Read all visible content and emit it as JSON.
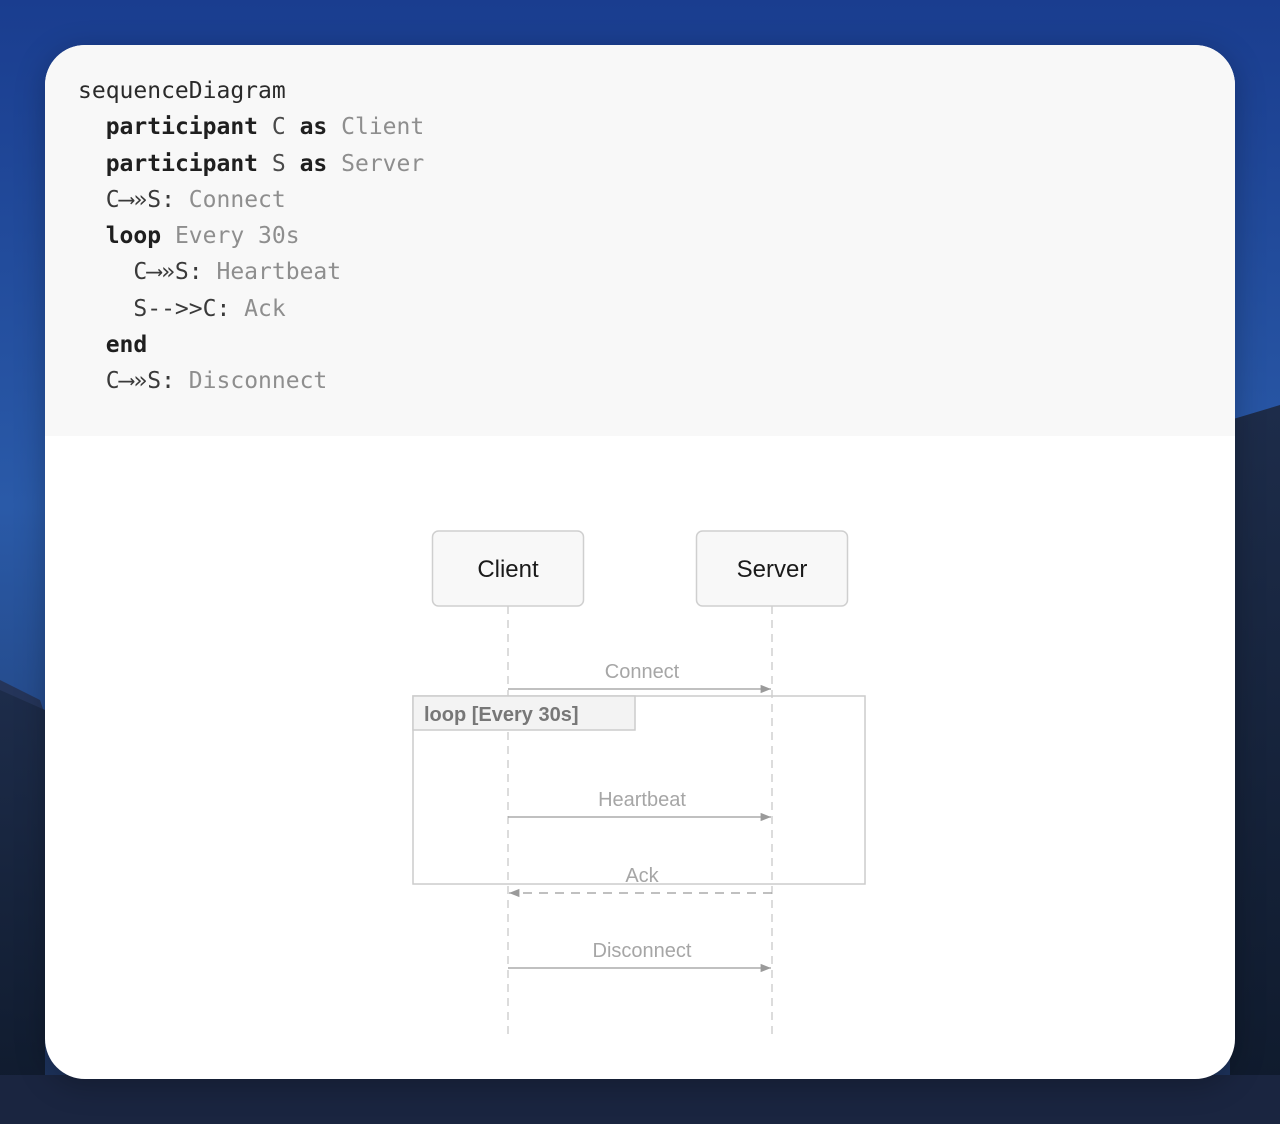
{
  "code": {
    "lines": [
      {
        "indent": "",
        "parts": [
          {
            "t": "sequenceDiagram",
            "c": "kw-plain"
          }
        ]
      },
      {
        "indent": "  ",
        "parts": [
          {
            "t": "participant",
            "c": "kw"
          },
          {
            "t": " C ",
            "c": "id"
          },
          {
            "t": "as",
            "c": "kw"
          },
          {
            "t": " Client",
            "c": "str"
          }
        ]
      },
      {
        "indent": "  ",
        "parts": [
          {
            "t": "participant",
            "c": "kw"
          },
          {
            "t": " S ",
            "c": "id"
          },
          {
            "t": "as",
            "c": "kw"
          },
          {
            "t": " Server",
            "c": "str"
          }
        ]
      },
      {
        "indent": "  ",
        "parts": [
          {
            "t": "C⟶»S:",
            "c": "op"
          },
          {
            "t": " Connect",
            "c": "str"
          }
        ]
      },
      {
        "indent": "  ",
        "parts": [
          {
            "t": "loop",
            "c": "kw"
          },
          {
            "t": " Every 30s",
            "c": "str"
          }
        ]
      },
      {
        "indent": "    ",
        "parts": [
          {
            "t": "C⟶»S:",
            "c": "op"
          },
          {
            "t": " Heartbeat",
            "c": "str"
          }
        ]
      },
      {
        "indent": "    ",
        "parts": [
          {
            "t": "S-->>C:",
            "c": "op"
          },
          {
            "t": " Ack",
            "c": "str"
          }
        ]
      },
      {
        "indent": "  ",
        "parts": [
          {
            "t": "end",
            "c": "kw"
          }
        ]
      },
      {
        "indent": "  ",
        "parts": [
          {
            "t": "C⟶»S:",
            "c": "op"
          },
          {
            "t": " Disconnect",
            "c": "str"
          }
        ]
      }
    ]
  },
  "diagram": {
    "participants": [
      {
        "id": "C",
        "label": "Client"
      },
      {
        "id": "S",
        "label": "Server"
      }
    ],
    "loop": {
      "label": "loop [Every 30s]"
    },
    "messages": [
      {
        "from": "C",
        "to": "S",
        "label": "Connect",
        "style": "solid"
      },
      {
        "from": "C",
        "to": "S",
        "label": "Heartbeat",
        "style": "solid"
      },
      {
        "from": "S",
        "to": "C",
        "label": "Ack",
        "style": "dashed"
      },
      {
        "from": "C",
        "to": "S",
        "label": "Disconnect",
        "style": "solid"
      }
    ],
    "colors": {
      "box_fill": "#f8f8f8",
      "box_stroke": "#cfcfcf",
      "lifeline": "#c4c4c4",
      "arrow": "#9a9a9a",
      "message_text": "#a6a6a6",
      "loop_stroke": "#cccccc",
      "loop_label_fill": "#f3f3f3",
      "loop_text": "#777777",
      "participant_text": "#1a1a1a"
    }
  }
}
